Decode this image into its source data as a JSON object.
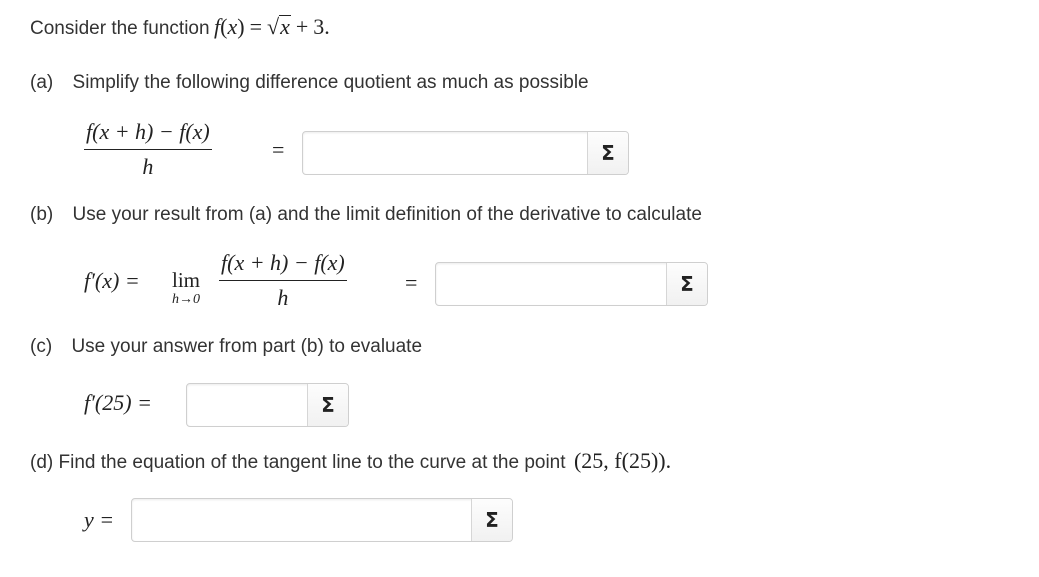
{
  "intro": {
    "text": "Consider the function",
    "f": "f",
    "x": "x",
    "sqrt_x": "x",
    "plus": "+",
    "three": "3",
    "period": "."
  },
  "part_a": {
    "label": "(a)",
    "text": "Simplify the following difference quotient as much as possible",
    "lhs_numerator": "f(x + h) − f(x)",
    "lhs_denominator": "h",
    "equals": "=",
    "answer_value": ""
  },
  "part_b": {
    "label": "(b)",
    "text": "Use your result from (a) and the limit definition of the derivative to calculate",
    "lhs": "f′(x) =",
    "lim": "lim",
    "lim_sub": "h→0",
    "numerator": "f(x + h) − f(x)",
    "denominator": "h",
    "equals": "=",
    "answer_value": ""
  },
  "part_c": {
    "label": "(c)",
    "text": "Use your answer from part (b) to evaluate",
    "lhs": "f′(25) =",
    "answer_value": ""
  },
  "part_d": {
    "text": "(d) Find the equation of the tangent line to the curve at the point",
    "point": "(25, f(25))",
    "period": ".",
    "lhs": "y =",
    "answer_value": ""
  },
  "sigma_icon": "Σ",
  "icons": {
    "sigma_button": "sigma-icon"
  }
}
